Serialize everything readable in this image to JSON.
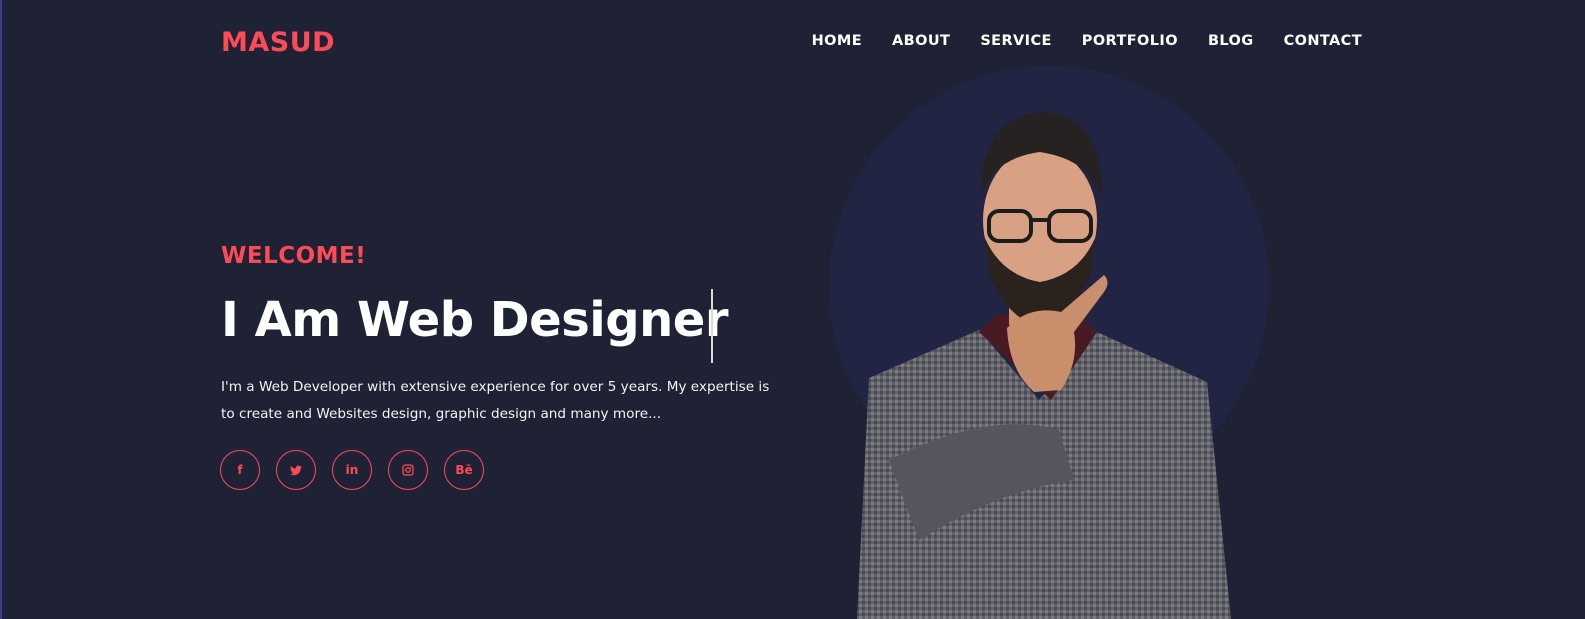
{
  "header": {
    "logo": "MASUD",
    "nav": [
      "HOME",
      "ABOUT",
      "SERVICE",
      "PORTFOLIO",
      "BLOG",
      "CONTACT"
    ]
  },
  "hero": {
    "welcome": "WELCOME!",
    "headline": "I Am Web Designer",
    "intro_line1": "I'm a Web Developer with extensive experience for over 5 years. My expertise is",
    "intro_line2": "to create and Websites design, graphic design and many more...",
    "socials": [
      {
        "icon": "facebook-icon",
        "glyph": "f"
      },
      {
        "icon": "twitter-icon",
        "glyph": ""
      },
      {
        "icon": "linkedin-icon",
        "glyph": "in"
      },
      {
        "icon": "instagram-icon",
        "glyph": ""
      },
      {
        "icon": "behance-icon",
        "glyph": "Bē"
      }
    ]
  },
  "colors": {
    "background": "#1f2235",
    "accent": "#ff4a57",
    "circle": "#222443"
  }
}
